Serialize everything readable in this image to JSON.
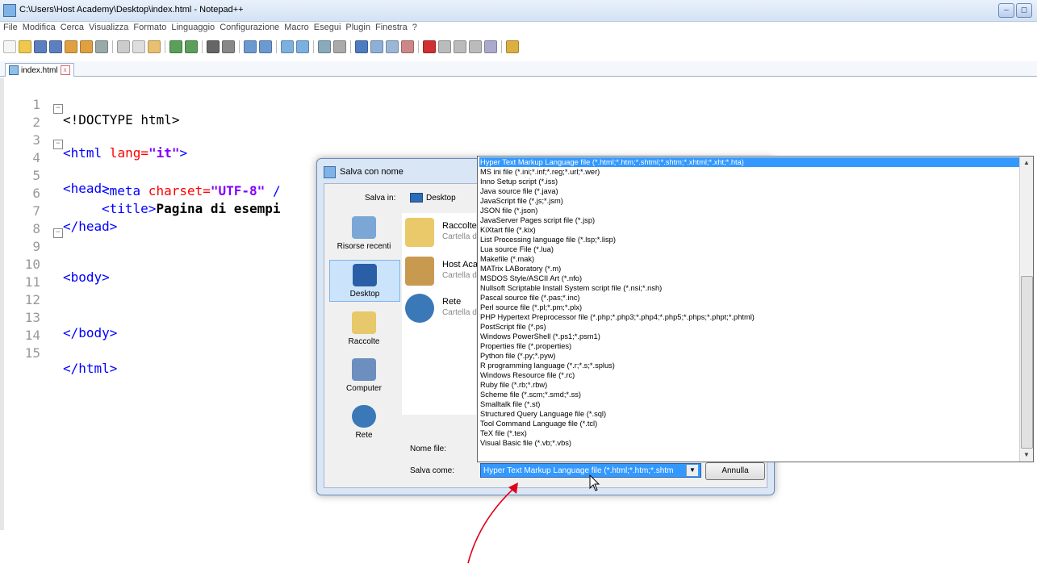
{
  "window": {
    "title": "C:\\Users\\Host Academy\\Desktop\\index.html - Notepad++",
    "min": "–",
    "max": "◻"
  },
  "menu": [
    "File",
    "Modifica",
    "Cerca",
    "Visualizza",
    "Formato",
    "Linguaggio",
    "Configurazione",
    "Macro",
    "Esegui",
    "Plugin",
    "Finestra",
    "?"
  ],
  "tab": {
    "label": "index.html",
    "close": "x"
  },
  "code": {
    "line_numbers": [
      "1",
      "2",
      "3",
      "4",
      "5",
      "6",
      "7",
      "8",
      "9",
      "10",
      "11",
      "12",
      "13",
      "14",
      "15"
    ],
    "l1": "<!DOCTYPE html>",
    "l2_open": "<html",
    "l2_attr": " lang=",
    "l2_val": "\"it\"",
    "l2_close": ">",
    "l4": "<head>",
    "l5_open": "<meta",
    "l5_attr": " charset=",
    "l5_val": "\"UTF-8\"",
    "l5_rest": " /",
    "l6_open": "<title>",
    "l6_text": "Pagina di esempi",
    "l7": "</head>",
    "l9": "<body>",
    "l13": "</body>",
    "l15": "</html>"
  },
  "dialog": {
    "title": "Salva con nome",
    "save_in_label": "Salva in:",
    "save_in_value": "Desktop",
    "places": [
      "Risorse recenti",
      "Desktop",
      "Raccolte",
      "Computer",
      "Rete"
    ],
    "files": [
      {
        "name": "Raccolte",
        "sub": "Cartella di sistema"
      },
      {
        "name": "Host Academy",
        "sub": "Cartella di sistema"
      },
      {
        "name": "Rete",
        "sub": "Cartella di sistema"
      }
    ],
    "file_name_label": "Nome file:",
    "save_as_label": "Salva come:",
    "save_as_value": "Hyper Text Markup Language file (*.html;*.htm;*.shtm",
    "cancel": "Annulla"
  },
  "dropdown": {
    "items": [
      "Hyper Text Markup Language file (*.html;*.htm;*.shtml;*.shtm;*.xhtml;*.xht;*.hta)",
      "MS ini file (*.ini;*.inf;*.reg;*.url;*.wer)",
      "Inno Setup script (*.iss)",
      "Java source file (*.java)",
      "JavaScript file (*.js;*.jsm)",
      "JSON file (*.json)",
      "JavaServer Pages script file (*.jsp)",
      "KiXtart file (*.kix)",
      "List Processing language file (*.lsp;*.lisp)",
      "Lua source File (*.lua)",
      "Makefile (*.mak)",
      "MATrix LABoratory (*.m)",
      "MSDOS Style/ASCII Art (*.nfo)",
      "Nullsoft Scriptable Install System script file (*.nsi;*.nsh)",
      "Pascal source file (*.pas;*.inc)",
      "Perl source file (*.pl;*.pm;*.plx)",
      "PHP Hypertext Preprocessor file (*.php;*.php3;*.php4;*.php5;*.phps;*.phpt;*.phtml)",
      "PostScript file (*.ps)",
      "Windows PowerShell (*.ps1;*.psm1)",
      "Properties file (*.properties)",
      "Python file (*.py;*.pyw)",
      "R programming language (*.r;*.s;*.splus)",
      "Windows Resource file (*.rc)",
      "Ruby file (*.rb;*.rbw)",
      "Scheme file (*.scm;*.smd;*.ss)",
      "Smalltalk file (*.st)",
      "Structured Query Language file (*.sql)",
      "Tool Command Language file (*.tcl)",
      "TeX file (*.tex)",
      "Visual Basic file (*.vb;*.vbs)"
    ]
  },
  "colors": {
    "accent": "#3399ff",
    "annotation": "#e0001b",
    "tag": "#0000ff",
    "attr": "#ff0000",
    "value": "#8000ff"
  }
}
